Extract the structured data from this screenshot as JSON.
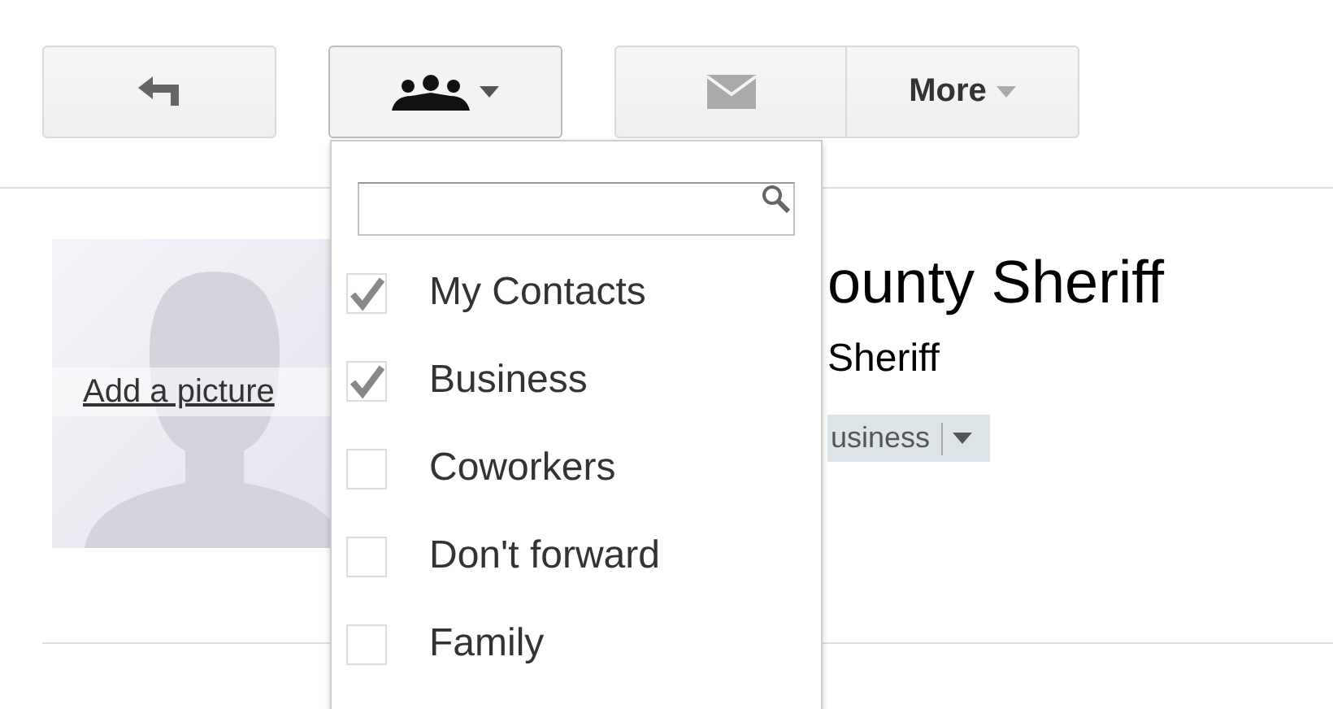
{
  "toolbar": {
    "more_label": "More"
  },
  "group_menu": {
    "items": [
      {
        "label": "My Contacts",
        "checked": true
      },
      {
        "label": "Business",
        "checked": true
      },
      {
        "label": "Coworkers",
        "checked": false
      },
      {
        "label": "Don't forward",
        "checked": false
      },
      {
        "label": "Family",
        "checked": false
      }
    ]
  },
  "contact": {
    "add_picture": "Add a picture",
    "name": "ounty Sheriff",
    "subtitle": "Sheriff",
    "group_tag": "usiness"
  }
}
